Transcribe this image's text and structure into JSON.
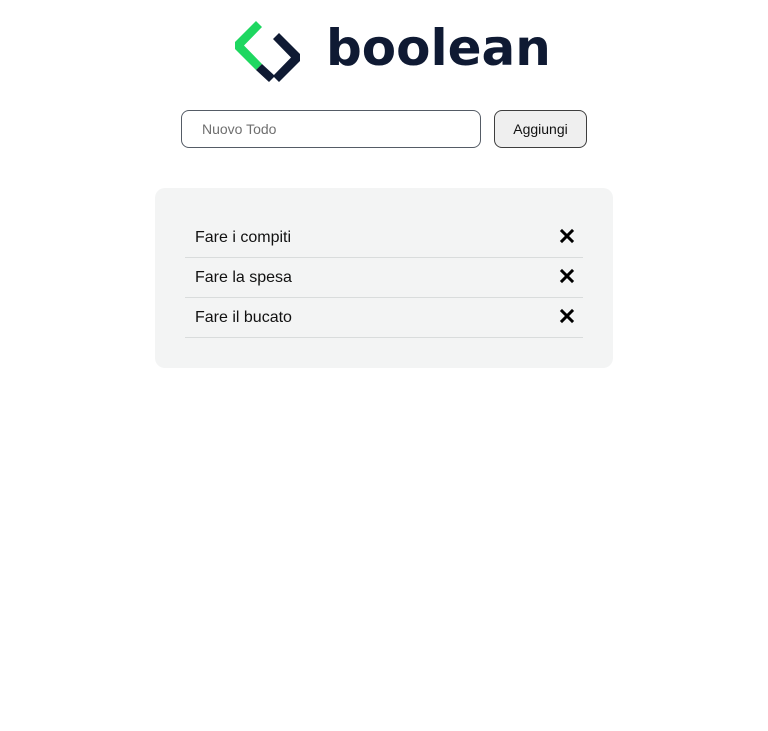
{
  "brand": {
    "name": "boolean",
    "colors": {
      "accent": "#1ed760",
      "dark": "#0f1a33"
    }
  },
  "form": {
    "input_value": "",
    "input_placeholder": "Nuovo Todo",
    "add_label": "Aggiungi"
  },
  "todos": [
    {
      "text": "Fare i compiti",
      "delete_icon": "close-icon"
    },
    {
      "text": "Fare la spesa",
      "delete_icon": "close-icon"
    },
    {
      "text": "Fare il bucato",
      "delete_icon": "close-icon"
    }
  ]
}
